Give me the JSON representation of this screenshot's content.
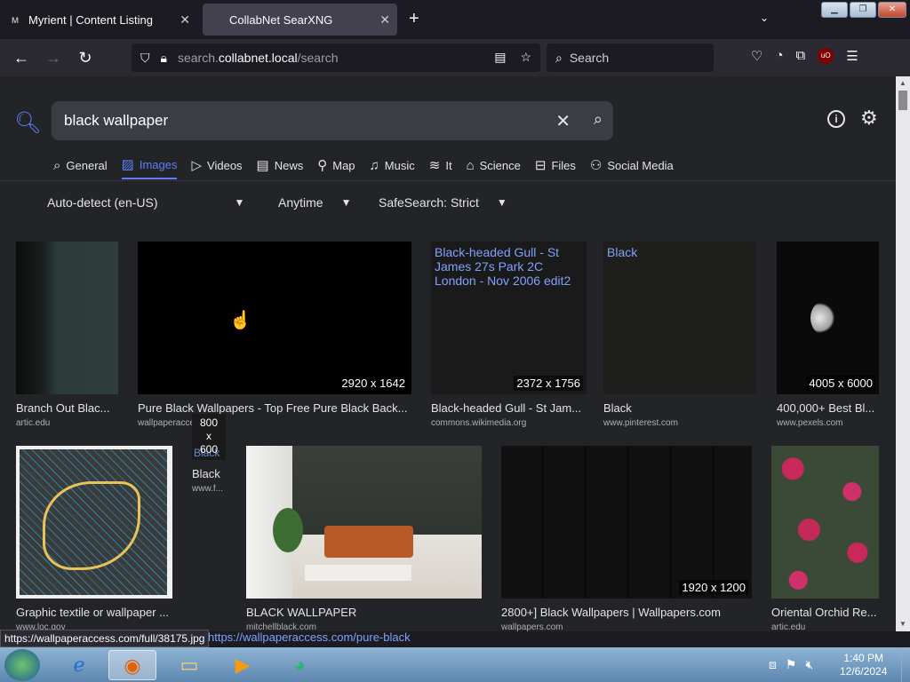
{
  "browser": {
    "tabs": [
      {
        "title": "Myrient | Content Listing",
        "favicon": "myrient-icon",
        "active": false
      },
      {
        "title": "CollabNet SearXNG",
        "favicon": "",
        "active": true
      }
    ],
    "url_prefix": "search.",
    "url_domain": "collabnet.local",
    "url_path": "/search",
    "search_placeholder": "Search",
    "ubo_label": "uO"
  },
  "search": {
    "query": "black wallpaper",
    "categories": [
      {
        "label": "General",
        "icon": "magnifier-icon"
      },
      {
        "label": "Images",
        "icon": "image-icon",
        "active": true
      },
      {
        "label": "Videos",
        "icon": "play-icon"
      },
      {
        "label": "News",
        "icon": "newspaper-icon"
      },
      {
        "label": "Map",
        "icon": "map-pin-icon"
      },
      {
        "label": "Music",
        "icon": "music-icon"
      },
      {
        "label": "It",
        "icon": "layers-icon"
      },
      {
        "label": "Science",
        "icon": "graduation-cap-icon"
      },
      {
        "label": "Files",
        "icon": "files-icon"
      },
      {
        "label": "Social Media",
        "icon": "people-icon"
      }
    ],
    "filters": {
      "language": "Auto-detect (en-US)",
      "time": "Anytime",
      "safesearch": "SafeSearch: Strict"
    }
  },
  "results": [
    {
      "title": "Branch Out Blac...",
      "source": "artic.edu",
      "dims": ""
    },
    {
      "title": "Pure Black Wallpapers - Top Free Pure Black Back...",
      "source": "wallpaperaccess.com",
      "dims": "2920 x 1642"
    },
    {
      "title": "Black-headed Gull - St Jam...",
      "source": "commons.wikimedia.org",
      "dims": "2372 x 1756",
      "alt": "Black-headed Gull - St James 27s Park 2C London - Nov 2006 edit2"
    },
    {
      "title": "Black",
      "source": "www.pinterest.com",
      "dims": "",
      "alt": "Black"
    },
    {
      "title": "400,000+ Best Bl...",
      "source": "www.pexels.com",
      "dims": "4005 x 6000"
    },
    {
      "title": "Graphic textile or wallpaper ...",
      "source": "www.loc.gov",
      "dims": ""
    },
    {
      "title": "Black",
      "source": "www.f...",
      "dims": "800 x 600",
      "alt": "Black"
    },
    {
      "title": "BLACK WALLPAPER",
      "source": "mitchellblack.com",
      "dims": ""
    },
    {
      "title": "2800+] Black Wallpapers | Wallpapers.com",
      "source": "wallpapers.com",
      "dims": "1920 x 1200"
    },
    {
      "title": "Oriental Orchid Re...",
      "source": "artic.edu",
      "dims": ""
    }
  ],
  "status": {
    "hover_url": "https://wallpaperaccess.com/full/38175.jpg",
    "link_url": "https://wallpaperaccess.com/pure-black"
  },
  "taskbar": {
    "time": "1:40 PM",
    "date": "12/6/2024"
  }
}
